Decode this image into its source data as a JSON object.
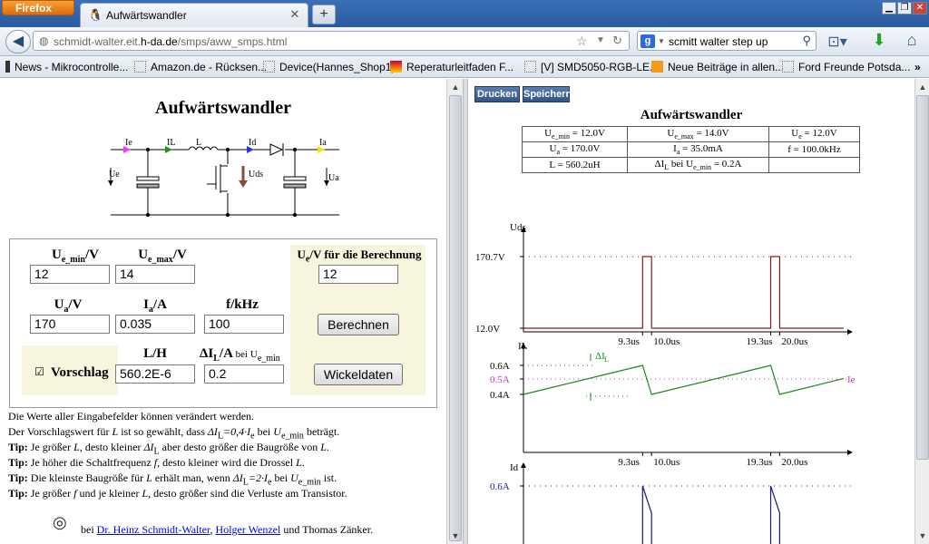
{
  "browser": {
    "app_button": "Firefox",
    "tab_title": "Aufwärtswandler",
    "url_prefix": "schmidt-walter.eit.",
    "url_domain": "h-da.de",
    "url_path": "/smps/aww_smps.html",
    "search_text": "scmitt walter step up",
    "search_engine": "g"
  },
  "bookmarks": [
    "News - Mikrocontrolle...",
    "Amazon.de - Rücksen...",
    "Device(Hannes_Shop1)",
    "Reperaturleitfaden F...",
    "[V] SMD5050-RGB-LE...",
    "Neue Beiträge in allen...",
    "Ford Freunde Potsda..."
  ],
  "left": {
    "title": "Aufwärtswandler",
    "circuit": {
      "labels": [
        "Ie",
        "IL",
        "L",
        "Id",
        "Ia",
        "Ue",
        "Uds",
        "Ua"
      ]
    },
    "form": {
      "ue_min_label": "U",
      "ue_min_sub": "e_min",
      "ue_min_unit": "/V",
      "ue_min_value": "12",
      "ue_max_label": "U",
      "ue_max_sub": "e_max",
      "ue_max_unit": "/V",
      "ue_max_value": "14",
      "ue_calc_label": "U",
      "ue_calc_sub": "e",
      "ue_calc_unit": "/V für die Berechnung",
      "ue_calc_value": "12",
      "ua_label": "U",
      "ua_sub": "a",
      "ua_unit": "/V",
      "ua_value": "170",
      "ia_label": "I",
      "ia_sub": "a",
      "ia_unit": "/A",
      "ia_value": "0.035",
      "f_label": "f/kHz",
      "f_value": "100",
      "calc_button": "Berechnen",
      "l_label": "L/H",
      "l_value": "560.2E-6",
      "dil_label": "ΔI",
      "dil_sub": "L",
      "dil_unit": "/A",
      "dil_extra": " bei U",
      "dil_extra_sub": "e_min",
      "dil_value": "0.2",
      "vorschlag_label": "Vorschlag",
      "vorschlag_checked": true,
      "wickel_button": "Wickeldaten"
    },
    "notes": {
      "n1": "Die Werte aller Eingabefelder können verändert werden.",
      "n2_a": "Der Vorschlagswert für ",
      "n2_b": "L",
      "n2_c": " ist so gewählt, dass ",
      "n2_d": "ΔI",
      "n2_e": "L",
      "n2_f": "=0,4·I",
      "n2_g": "e",
      "n2_h": " bei ",
      "n2_i": "U",
      "n2_j": "e_min",
      "n2_k": " beträgt.",
      "tip": "Tip:",
      "t1_a": " Je größer ",
      "t1_b": "L",
      "t1_c": ", desto kleiner ",
      "t1_d": "ΔI",
      "t1_e": "L",
      "t1_f": " aber desto größer die Baugröße von ",
      "t1_g": "L",
      "t1_h": ".",
      "t2_a": " Je höher die Schaltfrequenz ",
      "t2_b": "f",
      "t2_c": ", desto kleiner wird die Drossel ",
      "t2_d": "L",
      "t2_e": ".",
      "t3_a": " Die kleinste Baugröße für ",
      "t3_b": "L",
      "t3_c": " erhält man, wenn ",
      "t3_d": "ΔI",
      "t3_e": "L",
      "t3_f": "=2·I",
      "t3_g": "e",
      "t3_h": " bei ",
      "t3_i": "U",
      "t3_j": "e_min",
      "t3_k": " ist.",
      "t4_a": " Je größer ",
      "t4_b": "f",
      "t4_c": " und je kleiner ",
      "t4_d": "L",
      "t4_e": ", desto größer sind die Verluste am Transistor."
    },
    "credits": {
      "prefix": "bei ",
      "author1": "Dr. Heinz Schmidt-Walter",
      "sep": ", ",
      "author2": "Holger Wenzel",
      "suffix": " und Thomas Zänker."
    }
  },
  "right": {
    "print_button": "Drucken",
    "save_button": "Speichern",
    "title": "Aufwärtswandler",
    "table": [
      [
        {
          "m": "U",
          "s": "e_min",
          "v": " = 12.0V"
        },
        {
          "m": "U",
          "s": "e_max",
          "v": " = 14.0V"
        },
        {
          "m": "U",
          "s": "e",
          "v": " = 12.0V"
        }
      ],
      [
        {
          "m": "U",
          "s": "a",
          "v": " = 170.0V"
        },
        {
          "m": "I",
          "s": "a",
          "v": " = 35.0mA"
        },
        {
          "m": "",
          "s": "",
          "v": "f = 100.0kHz"
        }
      ],
      [
        {
          "m": "",
          "s": "",
          "v": "L = 560.2uH"
        },
        {
          "m": "ΔI",
          "s": "L",
          "v": " bei U",
          "s2": "e_min",
          "v2": " = 0.2A"
        },
        {
          "m": "",
          "s": "",
          "v": ""
        }
      ]
    ]
  },
  "chart_data": [
    {
      "type": "line",
      "ylabel": "Uds",
      "y_ticks": [
        "170.7V",
        "12.0V"
      ],
      "x_ticks": [
        "9.3us",
        "10.0us",
        "19.3us",
        "20.0us"
      ],
      "series": [
        {
          "x": [
            0,
            9.3,
            9.3,
            10.0,
            10.0,
            19.3,
            19.3,
            20.0,
            20.0,
            25
          ],
          "y": [
            12.0,
            12.0,
            170.7,
            170.7,
            12.0,
            12.0,
            170.7,
            170.7,
            12.0,
            12.0
          ]
        }
      ],
      "xlim": [
        0,
        25
      ],
      "ylim": [
        12.0,
        170.7
      ],
      "colors": {
        "line": "#8b1a1a",
        "ref": "#8b1a1a"
      }
    },
    {
      "type": "line",
      "ylabel": "IL",
      "y_ticks": [
        "0.6A",
        "0.5A",
        "0.4A"
      ],
      "x_ticks": [
        "9.3us",
        "10.0us",
        "19.3us",
        "20.0us"
      ],
      "annotations": [
        "ΔI",
        "L",
        "Ie"
      ],
      "series": [
        {
          "x": [
            0,
            9.3,
            10.0,
            19.3,
            20.0,
            25
          ],
          "y": [
            0.4,
            0.6,
            0.4,
            0.6,
            0.4,
            0.51
          ]
        }
      ],
      "xlim": [
        0,
        25
      ],
      "ylim": [
        0.3,
        0.7
      ],
      "colors": {
        "line": "#1a8a1a",
        "ie": "#cc33cc"
      }
    },
    {
      "type": "line",
      "ylabel": "Id",
      "y_ticks": [
        "0.6A"
      ],
      "x_ticks": [],
      "series": [
        {
          "x": [
            9.3,
            9.3,
            10.0,
            10.0
          ],
          "y": [
            0,
            0.6,
            0.4,
            0
          ]
        },
        {
          "x": [
            19.3,
            19.3,
            20.0,
            20.0
          ],
          "y": [
            0,
            0.6,
            0.4,
            0
          ]
        }
      ],
      "xlim": [
        0,
        25
      ],
      "ylim": [
        0,
        0.7
      ],
      "colors": {
        "line": "#1a1a8a"
      }
    }
  ]
}
